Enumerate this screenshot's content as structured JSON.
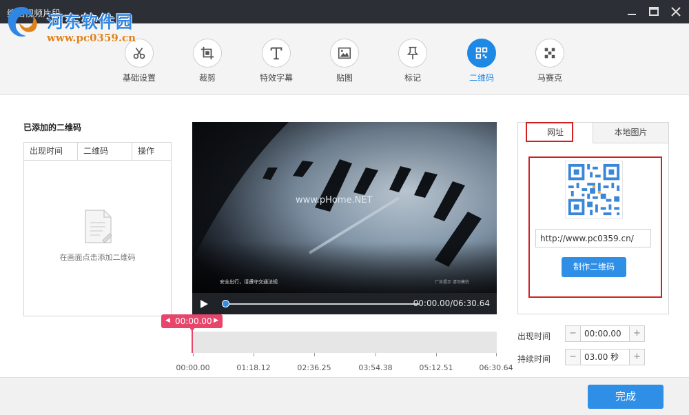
{
  "window": {
    "title": "编辑视频片段",
    "watermark_site": "河东软件园",
    "watermark_url": "www.pc0359.cn"
  },
  "toolbar": {
    "items": [
      {
        "label": "基础设置",
        "icon": "scissors-icon"
      },
      {
        "label": "裁剪",
        "icon": "crop-icon"
      },
      {
        "label": "特效字幕",
        "icon": "text-icon"
      },
      {
        "label": "贴图",
        "icon": "image-icon"
      },
      {
        "label": "标记",
        "icon": "pin-icon"
      },
      {
        "label": "二维码",
        "icon": "qrcode-icon",
        "active": true
      },
      {
        "label": "马赛克",
        "icon": "mosaic-icon"
      }
    ]
  },
  "left_panel": {
    "title": "已添加的二维码",
    "columns": [
      "出现时间",
      "二维码",
      "操作"
    ],
    "empty_text": "在画面点击添加二维码"
  },
  "video": {
    "watermark": "www.pHome.NET",
    "subtitle_left": "安全出行，请遵守交通法规",
    "subtitle_right": "广告提示 请勿模仿",
    "time": "00:00.00/06:30.64",
    "progress": 0
  },
  "timeline": {
    "marker": "00:00.00",
    "ticks": [
      "00:00.00",
      "01:18.12",
      "02:36.25",
      "03:54.38",
      "05:12.51",
      "06:30.64"
    ]
  },
  "right_panel": {
    "tabs": [
      "网址",
      "本地图片"
    ],
    "url_value": "http://www.pc0359.cn/",
    "make_button": "制作二维码",
    "appear_label": "出现时间",
    "appear_value": "00:00.00",
    "duration_label": "持续时间",
    "duration_value": "03.00 秒"
  },
  "footer": {
    "done": "完成"
  },
  "colors": {
    "accent": "#2f8fe6",
    "marker": "#e8456b",
    "highlight": "#d31f1f",
    "titlebar": "#2d2f36"
  }
}
